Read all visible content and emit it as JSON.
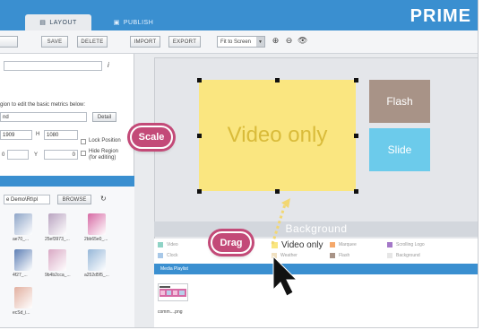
{
  "brand": "PRIME",
  "tabs": [
    {
      "label": "LAYOUT"
    },
    {
      "label": "PUBLISH"
    }
  ],
  "toolbar": {
    "save": "SAVE",
    "delete": "DELETE",
    "import": "IMPORT",
    "export": "EXPORT",
    "fit_select": "Fit to Screen"
  },
  "left_panel": {
    "info_icon": "i",
    "hint": "gion to edit the basic metrics below:",
    "name_value": "nd",
    "detail_button": "Detail",
    "x_value": "1909",
    "h_label": "H",
    "h_value": "1080",
    "lock_position": "Lock Position",
    "y_label": "Y",
    "y_value": "0",
    "hide_region": "Hide Region",
    "hide_region_sub": "(for editing)",
    "x_partial": "0",
    "media_path": "e Demo\\Rt\\pl",
    "browse": "BROWSE",
    "refresh_icon": "↻"
  },
  "media_thumbs": [
    {
      "label": "ae70_...",
      "color": "#8ea5c8"
    },
    {
      "label": "25ef3973_...",
      "color": "#b9a3c0"
    },
    {
      "label": "2bb65e0_...",
      "color": "#d66aa4"
    },
    {
      "label": "4f27_...",
      "color": "#5e7fb5"
    },
    {
      "label": "9b4b2cca_...",
      "color": "#d9a8c4"
    },
    {
      "label": "a252d5f5_...",
      "color": "#96b7d8"
    },
    {
      "label": "ecSd_i...",
      "color": "#e2b0a0"
    }
  ],
  "stage": {
    "video_zone": "Video only",
    "flash_zone": "Flash",
    "slide_zone": "Slide",
    "background": "Background"
  },
  "legend": [
    {
      "label": "Video",
      "color": "#8fd3c6"
    },
    {
      "label": "Clock",
      "color": "#a8c8e8"
    },
    {
      "label": "Weather",
      "color": "#f0e0c0"
    },
    {
      "label": "Marquee",
      "color": "#f5a86a"
    },
    {
      "label": "Flash",
      "color": "#a89387"
    },
    {
      "label": "Scrolling Logo",
      "color": "#a478c8"
    },
    {
      "label": "Background",
      "color": "#e6e6e6"
    }
  ],
  "legend_video_only": {
    "label": "Video only",
    "color": "#fae680"
  },
  "playlist": {
    "header": "Media Playlist",
    "item_label": "comm....png"
  },
  "callouts": {
    "scale": "Scale",
    "drag": "Drag"
  },
  "colors": {
    "accent": "#3a8fd0",
    "callout": "#c34a78",
    "video_zone": "#fae680",
    "flash_zone": "#a89387",
    "slide_zone": "#6ccbeb"
  }
}
